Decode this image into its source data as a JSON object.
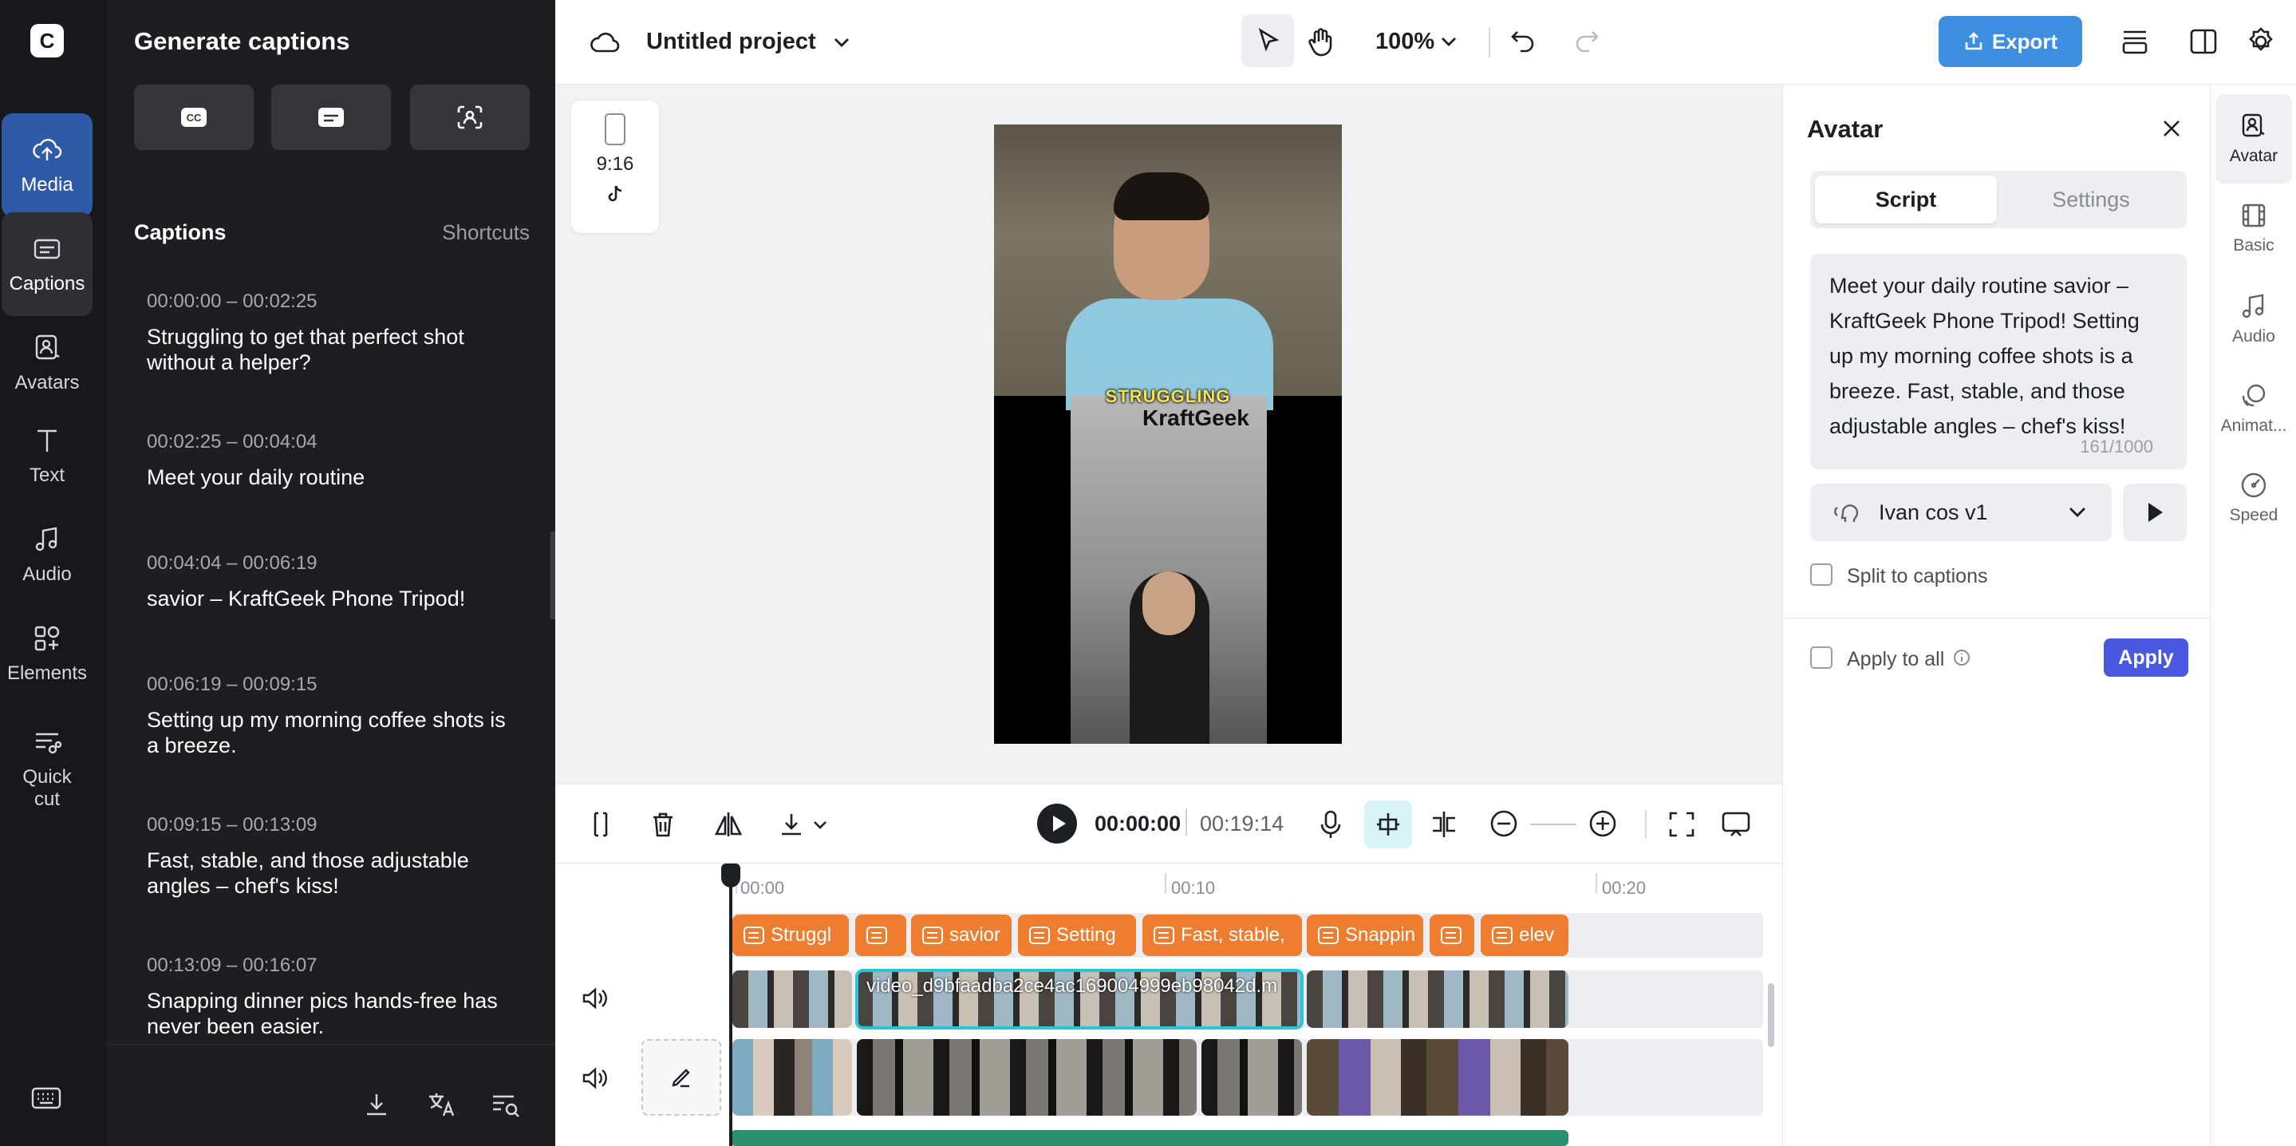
{
  "nav": {
    "logo_glyph": "C",
    "items": [
      {
        "label": "Media",
        "icon": "cloud-upload-icon"
      },
      {
        "label": "Captions",
        "icon": "captions-icon"
      },
      {
        "label": "Avatars",
        "icon": "avatar-icon"
      },
      {
        "label": "Text",
        "icon": "text-icon"
      },
      {
        "label": "Audio",
        "icon": "music-note-icon"
      },
      {
        "label": "Elements",
        "icon": "elements-icon"
      },
      {
        "label": "Quick cut",
        "icon": "quick-cut-icon"
      }
    ]
  },
  "captions_panel": {
    "title": "Generate captions",
    "section_title": "Captions",
    "shortcuts_label": "Shortcuts",
    "items": [
      {
        "time": "00:00:00 – 00:02:25",
        "text": "Struggling to get that perfect shot without a helper?"
      },
      {
        "time": "00:02:25 – 00:04:04",
        "text": "Meet your daily routine"
      },
      {
        "time": "00:04:04 – 00:06:19",
        "text": "savior – KraftGeek Phone Tripod!"
      },
      {
        "time": "00:06:19 – 00:09:15",
        "text": "Setting up my morning coffee shots is a breeze."
      },
      {
        "time": "00:09:15 – 00:13:09",
        "text": "Fast, stable, and those adjustable angles – chef's kiss!"
      },
      {
        "time": "00:13:09 – 00:16:07",
        "text": "Snapping dinner pics hands-free has never been easier."
      }
    ]
  },
  "topbar": {
    "project_title": "Untitled project",
    "zoom": "100%",
    "export_label": "Export"
  },
  "canvas": {
    "aspect_ratio": "9:16",
    "caption_overlay": "STRUGGLING",
    "brand_overlay": "KraftGeek"
  },
  "playback": {
    "current_time": "00:00:00",
    "duration": "00:19:14"
  },
  "timeline": {
    "ticks": [
      "00:00",
      "00:10",
      "00:20"
    ],
    "caption_clips": [
      "Struggl",
      "",
      "savior",
      "Setting",
      "Fast, stable,",
      "Snappin",
      "",
      "elev"
    ],
    "main_clip_label": "video_d9bfaadba2ce4ac169004999eb98042d.m"
  },
  "avatar_panel": {
    "title": "Avatar",
    "tabs": [
      "Script",
      "Settings"
    ],
    "script_text": "Meet your daily routine savior – KraftGeek Phone Tripod! Setting up my morning coffee shots is a breeze. Fast, stable, and those adjustable angles – chef's kiss!",
    "char_count": "161/1000",
    "voice_name": "Ivan cos v1",
    "split_label": "Split to captions",
    "apply_all_label": "Apply to all",
    "apply_label": "Apply"
  },
  "tool_rail": {
    "items": [
      "Avatar",
      "Basic",
      "Audio",
      "Animat...",
      "Speed"
    ]
  },
  "colors": {
    "accent": "#3d8de0",
    "caption_clip": "#ef7d2f",
    "selection": "#27c6d6",
    "apply": "#4a57e0"
  }
}
